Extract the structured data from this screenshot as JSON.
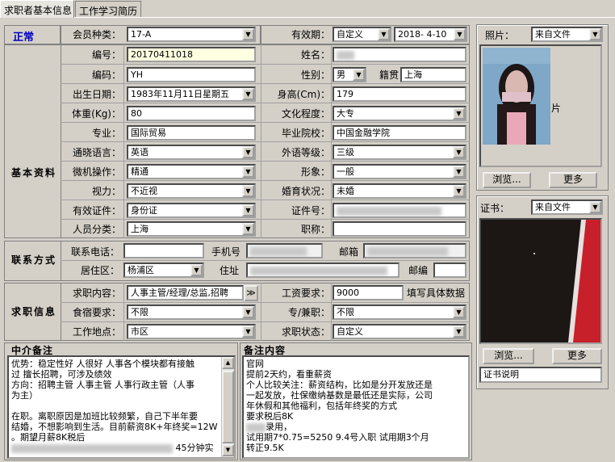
{
  "tabs": [
    "求职者基本信息",
    "工作学习简历"
  ],
  "status": "正常",
  "section_basic": "基本资料",
  "section_contact": "联系方式",
  "section_job": "求职信息",
  "member_type": {
    "label": "会员种类：",
    "value": "17-A"
  },
  "validity": {
    "label": "有效期：",
    "mode": "自定义",
    "date": "2018- 4-10"
  },
  "fields": {
    "number": {
      "label": "编号：",
      "value": "20170411018"
    },
    "name": {
      "label": "姓名："
    },
    "code": {
      "label": "编码：",
      "value": "YH"
    },
    "gender": {
      "label": "性别：",
      "value": "男"
    },
    "native": {
      "label": "籍贯",
      "value": "上海"
    },
    "birth": {
      "label": "出生日期：",
      "value": "1983年11月11日星期五"
    },
    "height": {
      "label": "身高(Cm)：",
      "value": "179"
    },
    "weight": {
      "label": "体重(Kg)：",
      "value": "80"
    },
    "education": {
      "label": "文化程度：",
      "value": "大专"
    },
    "major": {
      "label": "专业：",
      "value": "国际贸易"
    },
    "school": {
      "label": "毕业院校：",
      "value": "中国金融学院"
    },
    "language": {
      "label": "通晓语言：",
      "value": "英语"
    },
    "lang_level": {
      "label": "外语等级：",
      "value": "三级"
    },
    "computer": {
      "label": "微机操作：",
      "value": "精通"
    },
    "image": {
      "label": "形象：",
      "value": "一般"
    },
    "vision": {
      "label": "视力：",
      "value": "不近视"
    },
    "marital": {
      "label": "婚育状况：",
      "value": "未婚"
    },
    "id_type": {
      "label": "有效证件：",
      "value": "身份证"
    },
    "id_no": {
      "label": "证件号："
    },
    "category": {
      "label": "人员分类：",
      "value": "上海"
    },
    "title": {
      "label": "职称："
    }
  },
  "contact": {
    "phone": {
      "label": "联系电话："
    },
    "mobile": {
      "label": "手机号"
    },
    "email": {
      "label": "邮箱"
    },
    "district": {
      "label": "居住区：",
      "value": "杨浦区"
    },
    "address": {
      "label": "住址"
    },
    "zip": {
      "label": "邮编"
    }
  },
  "job": {
    "content": {
      "label": "求职内容：",
      "value": "人事主管/经理/总监,招聘"
    },
    "salary": {
      "label": "工资要求：",
      "value": "9000",
      "hint": "填写具体数据"
    },
    "board": {
      "label": "食宿要求：",
      "value": "不限"
    },
    "parttime": {
      "label": "专/兼职：",
      "value": "不限"
    },
    "location": {
      "label": "工作地点：",
      "value": "市区"
    },
    "state": {
      "label": "求职状态：",
      "value": "自定义"
    }
  },
  "expand_btn": "≫",
  "agent_notes": {
    "title": "中介备注",
    "lines": [
      "优势：稳定性好  人很好  人事各个模块都有接触",
      "过  擅长招聘，可涉及绩效",
      "方向：招聘主管  人事主管  人事行政主管（人事",
      "为主）",
      "",
      "在职。离职原因是加班比较频繁，自己下半年要",
      "结婚，不想影响到生活。目前薪资8K+年终奖=12W",
      "。期望月薪8K税后"
    ],
    "last_suffix": "45分钟实"
  },
  "remarks": {
    "title": "备注内容",
    "lines": [
      "官网",
      "提前2天约，看重薪资",
      "个人比较关注：薪资结构，比如是分开发放还是",
      "一起发放，社保缴纳基数是最低还是实际，公司",
      "年休假和其他福利，包括年终奖的方式",
      "要求税后8K",
      "录用，",
      "试用期7*0.75=5250  9.4号入职  试用期3个月",
      "转正9.5K"
    ]
  },
  "photo": {
    "label": "照片：",
    "source": "来自文件",
    "caption": "片",
    "browse": "浏览...",
    "more": "更多"
  },
  "cert": {
    "label": "证书：",
    "source": "来自文件",
    "browse": "浏览...",
    "more": "更多",
    "desc": "证书说明"
  }
}
